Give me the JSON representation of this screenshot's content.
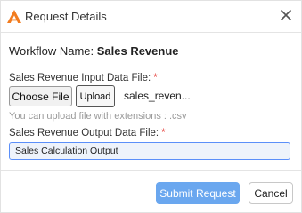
{
  "dialog": {
    "title": "Request Details",
    "logo_icon": "brand-logo-icon",
    "close_icon": "close-icon"
  },
  "workflow": {
    "label": "Workflow Name: ",
    "name": "Sales Revenue"
  },
  "input_file": {
    "label": "Sales Revenue Input Data File:",
    "required_mark": "*",
    "choose_label": "Choose File",
    "upload_label": "Upload",
    "file_name": "sales_reven...",
    "hint": "You can upload file with extensions : .csv"
  },
  "output_file": {
    "label": "Sales Revenue Output Data File:",
    "required_mark": "*",
    "value": "Sales Calculation Output"
  },
  "footer": {
    "submit_label": "Submit Request",
    "cancel_label": "Cancel"
  },
  "colors": {
    "accent": "#6aa7ef",
    "brand": "#f27c1f",
    "required": "#e53935",
    "focus_border": "#5b8ff9"
  }
}
